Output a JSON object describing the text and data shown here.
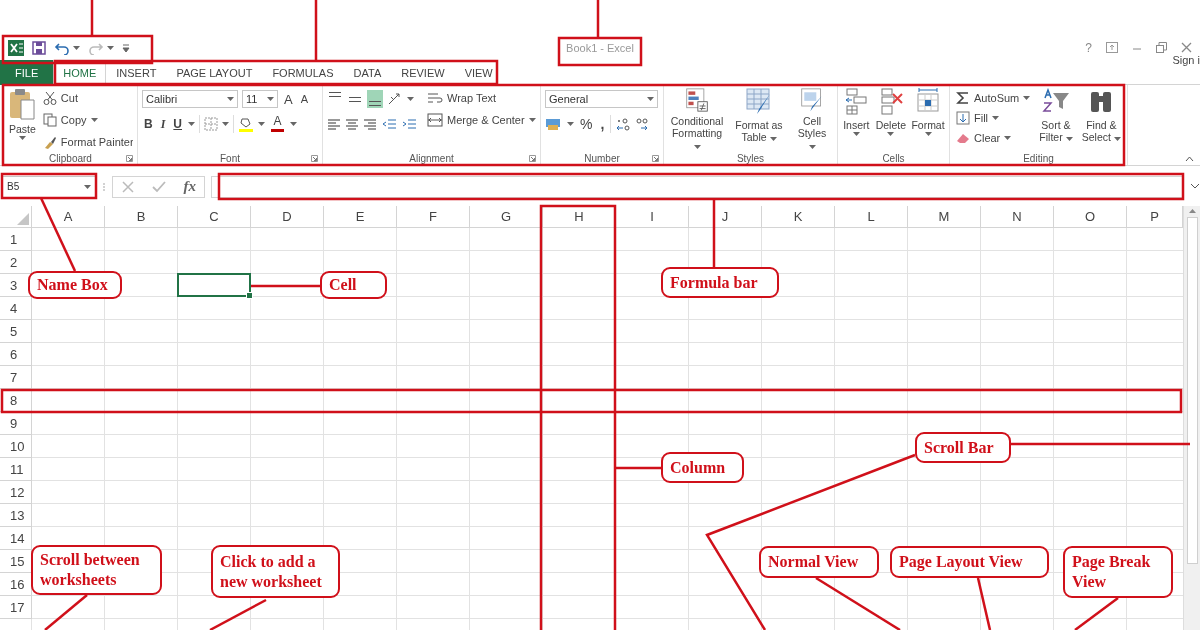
{
  "window": {
    "title": "Book1 - Excel",
    "help": "?",
    "sign_in": "Sign i"
  },
  "tabs": [
    {
      "label": "FILE",
      "kind": "file",
      "selected": false
    },
    {
      "label": "HOME",
      "kind": "tab",
      "selected": true
    },
    {
      "label": "INSERT",
      "kind": "tab",
      "selected": false
    },
    {
      "label": "PAGE LAYOUT",
      "kind": "tab",
      "selected": false
    },
    {
      "label": "FORMULAS",
      "kind": "tab",
      "selected": false
    },
    {
      "label": "DATA",
      "kind": "tab",
      "selected": false
    },
    {
      "label": "REVIEW",
      "kind": "tab",
      "selected": false
    },
    {
      "label": "VIEW",
      "kind": "tab",
      "selected": false
    }
  ],
  "ribbon": {
    "groups": [
      {
        "kind": "clipboard",
        "name": "Clipboard",
        "paste": "Paste",
        "cut": "Cut",
        "copy": "Copy",
        "format_painter": "Format Painter"
      },
      {
        "kind": "font",
        "name": "Font",
        "font_name": "Calibri",
        "font_size": "11",
        "grow": "A",
        "shrink": "A",
        "bold": "B",
        "italic": "I",
        "underline": "U",
        "font_color": "A"
      },
      {
        "kind": "alignment",
        "name": "Alignment",
        "vertical_align": [
          {
            "selected": false
          },
          {
            "selected": false
          },
          {
            "selected": true
          }
        ],
        "wrap_text": "Wrap Text",
        "merge_center": "Merge & Center"
      },
      {
        "kind": "number",
        "name": "Number",
        "format": "General",
        "percent": "%",
        "comma": ","
      },
      {
        "kind": "styles",
        "name": "Styles",
        "buttons": [
          "Conditional Formatting",
          "Format as Table",
          "Cell Styles"
        ]
      },
      {
        "kind": "cells",
        "name": "Cells",
        "buttons": [
          "Insert",
          "Delete",
          "Format"
        ]
      },
      {
        "kind": "editing",
        "name": "Editing",
        "autosum": "AutoSum",
        "fill": "Fill",
        "clear": "Clear",
        "sort": "Sort & Filter",
        "find": "Find & Select"
      }
    ]
  },
  "formula_bar": {
    "name_box": "B5",
    "fx": "fx"
  },
  "grid": {
    "columns": [
      {
        "label": "A",
        "selected": false
      },
      {
        "label": "B",
        "selected": false
      },
      {
        "label": "C",
        "selected": true
      },
      {
        "label": "D",
        "selected": false
      },
      {
        "label": "E",
        "selected": false
      },
      {
        "label": "F",
        "selected": false
      },
      {
        "label": "G",
        "selected": false
      },
      {
        "label": "H",
        "selected": false
      },
      {
        "label": "I",
        "selected": false
      },
      {
        "label": "J",
        "selected": false
      },
      {
        "label": "K",
        "selected": false
      },
      {
        "label": "L",
        "selected": false
      },
      {
        "label": "M",
        "selected": false
      },
      {
        "label": "N",
        "selected": false
      },
      {
        "label": "O",
        "selected": false
      },
      {
        "label": "P",
        "selected": false
      }
    ],
    "rows": [
      {
        "label": "1",
        "selected": false
      },
      {
        "label": "2",
        "selected": false
      },
      {
        "label": "3",
        "selected": true
      },
      {
        "label": "4",
        "selected": false
      },
      {
        "label": "5",
        "selected": false
      },
      {
        "label": "6",
        "selected": false
      },
      {
        "label": "7",
        "selected": false
      },
      {
        "label": "8",
        "selected": false
      },
      {
        "label": "9",
        "selected": false
      },
      {
        "label": "10",
        "selected": false
      },
      {
        "label": "11",
        "selected": false
      },
      {
        "label": "12",
        "selected": false
      },
      {
        "label": "13",
        "selected": false
      },
      {
        "label": "14",
        "selected": false
      },
      {
        "label": "15",
        "selected": false
      },
      {
        "label": "16",
        "selected": false
      },
      {
        "label": "17",
        "selected": false
      }
    ]
  },
  "annotations": [
    "Name Box",
    "Cell",
    "Formula bar",
    "Scroll Bar",
    "Column",
    "Scroll between worksheets",
    "Click to add a new worksheet",
    "Normal View",
    "Page Layout View",
    "Page Break View"
  ]
}
